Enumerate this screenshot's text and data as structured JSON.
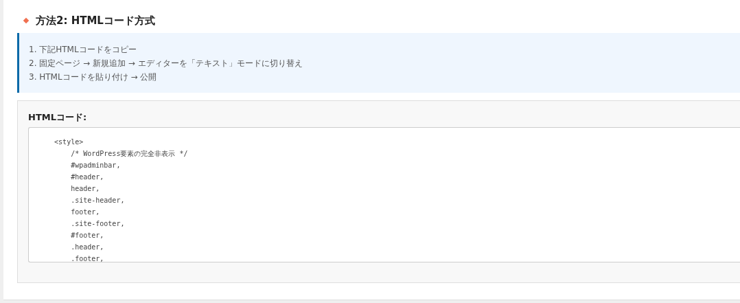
{
  "heading": "方法2: HTMLコード方式",
  "steps": [
    "1. 下記HTMLコードをコピー",
    "2. 固定ページ → 新規追加 → エディターを「テキスト」モードに切り替え",
    "3. HTMLコードを貼り付け → 公開"
  ],
  "code_panel": {
    "label": "HTMLコード:",
    "lines": [
      "    <style>",
      "        /* WordPress要素の完全非表示 */",
      "        #wpadminbar,",
      "        #header,",
      "        header,",
      "        .site-header,",
      "        footer,",
      "        .site-footer,",
      "        #footer,",
      "        .header,",
      "        .footer,"
    ]
  }
}
